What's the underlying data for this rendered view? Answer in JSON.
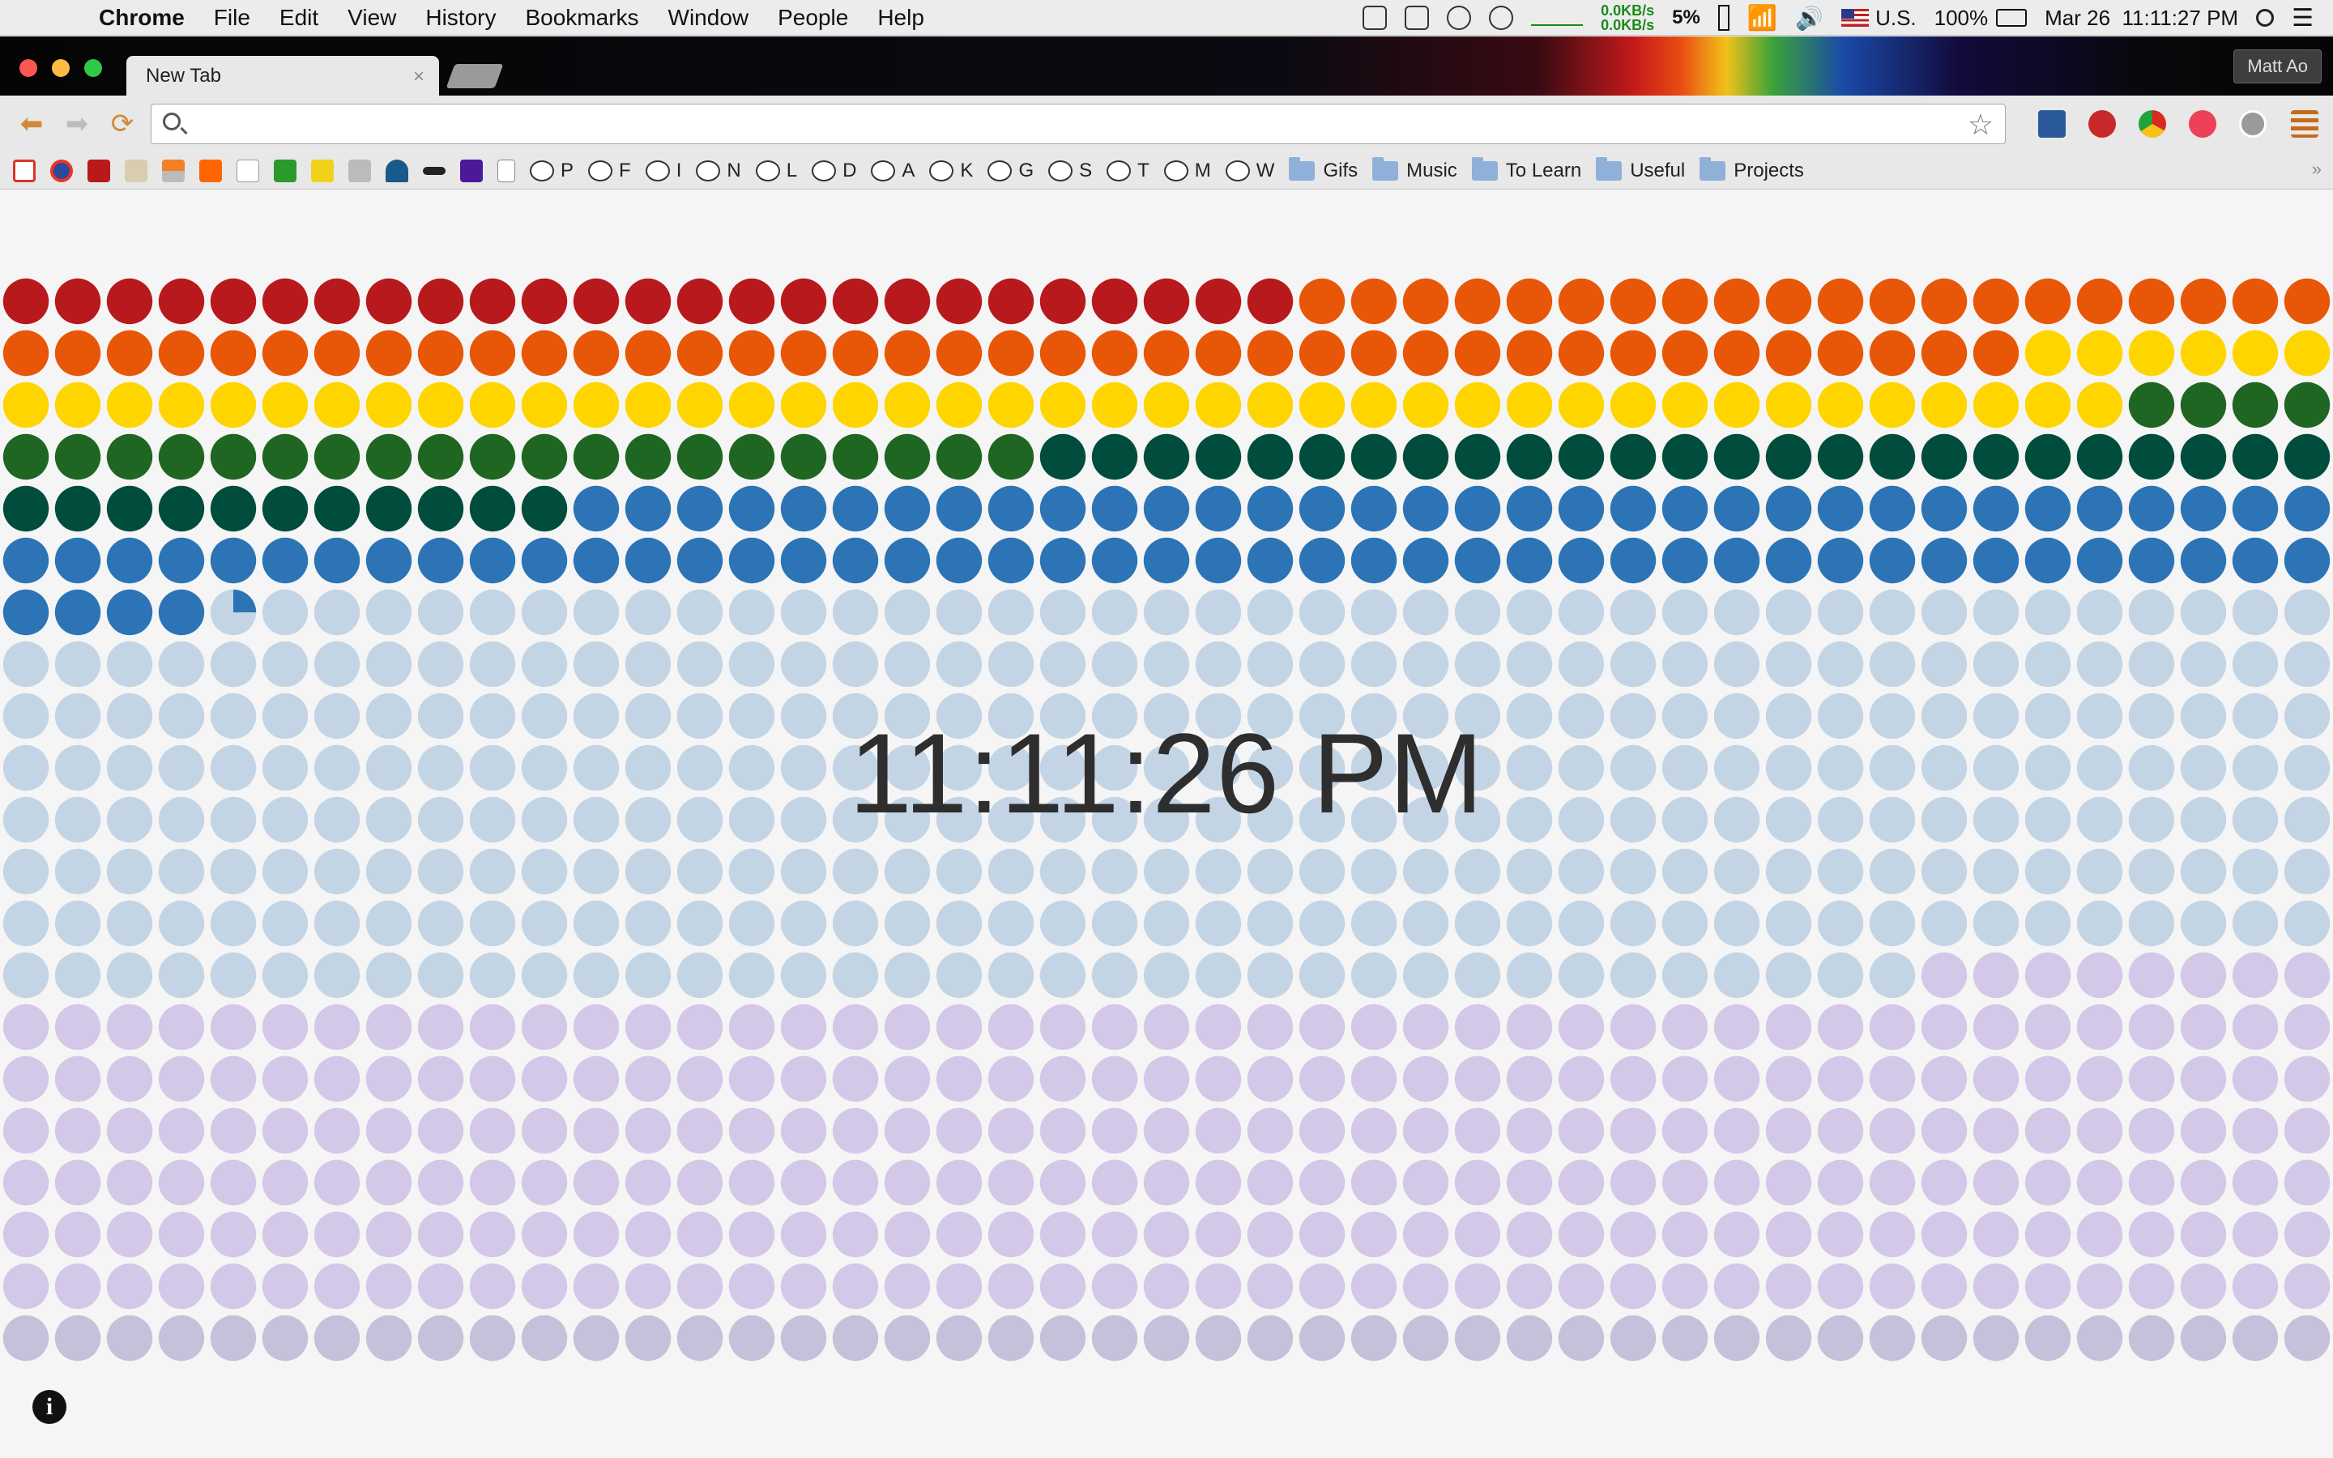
{
  "menubar": {
    "app": "Chrome",
    "items": [
      "File",
      "Edit",
      "View",
      "History",
      "Bookmarks",
      "Window",
      "People",
      "Help"
    ],
    "net_up": "0.0KB/s",
    "net_down": "0.0KB/s",
    "cpu": "5%",
    "input_source": "U.S.",
    "battery": "100%",
    "datetime": "Mar 26  11:11:27 PM"
  },
  "window": {
    "tab_title": "New Tab",
    "profile": "Matt Ao"
  },
  "omnibox": {
    "value": "",
    "placeholder": ""
  },
  "bookmarks": {
    "reddit_items": [
      "P",
      "F",
      "I",
      "N",
      "L",
      "D",
      "A",
      "K",
      "G",
      "S",
      "T",
      "M",
      "W"
    ],
    "folders": [
      "Gifs",
      "Music",
      "To Learn",
      "Useful",
      "Projects"
    ]
  },
  "clock": {
    "time": "11:11:26 PM",
    "dots_per_row": 45,
    "rows": 21,
    "filled_dots": 274,
    "partial_dot_fraction": 0.25,
    "colors": {
      "filled": [
        "#b8191c",
        "#e85707",
        "#ffd500",
        "#1f6623",
        "#004d3d",
        "#2c74b5"
      ],
      "empty": [
        "#c3d5e5",
        "#d4c8e8",
        "#c7c0da"
      ]
    }
  }
}
